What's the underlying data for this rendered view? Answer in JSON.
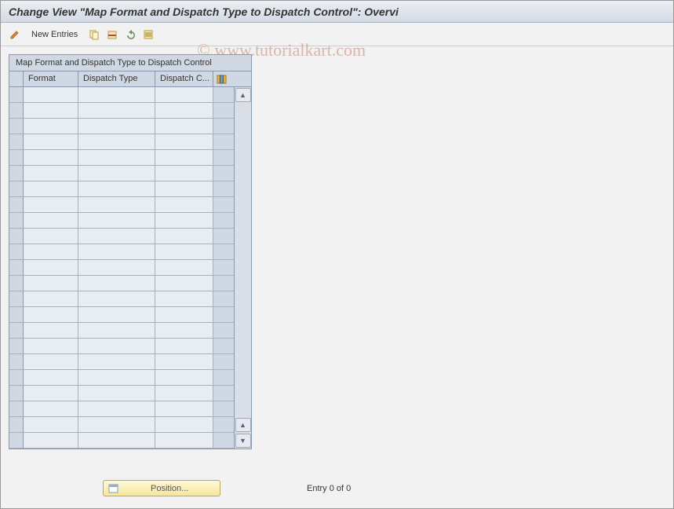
{
  "title": "Change View \"Map Format and Dispatch Type to Dispatch Control\": Overvi",
  "toolbar": {
    "new_entries": "New Entries"
  },
  "table": {
    "title": "Map Format and Dispatch Type to Dispatch Control",
    "columns": {
      "c1": "Format",
      "c2": "Dispatch Type",
      "c3": "Dispatch C..."
    },
    "row_count": 23
  },
  "footer": {
    "position_label": "Position...",
    "entry_text": "Entry 0 of 0"
  },
  "watermark": "© www.tutorialkart.com"
}
